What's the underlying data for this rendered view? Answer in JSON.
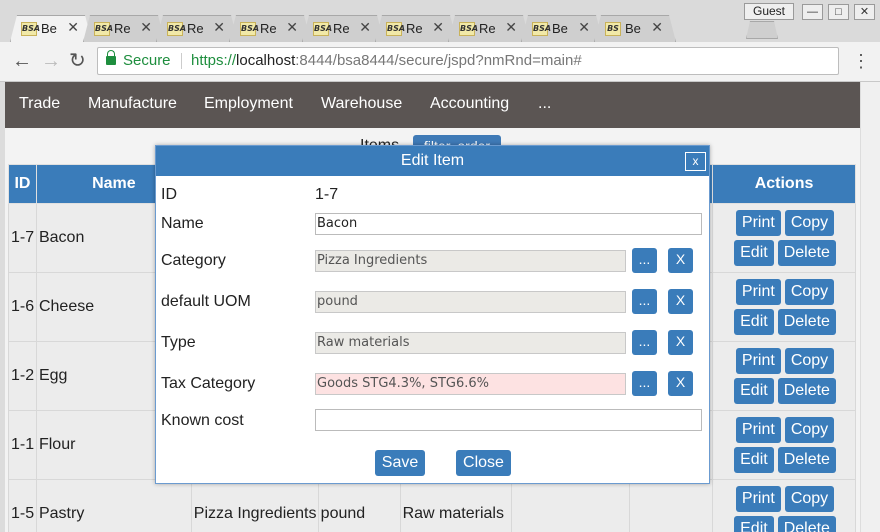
{
  "browser": {
    "tabs": [
      {
        "favicon": "BSA",
        "title": "Be"
      },
      {
        "favicon": "BSA",
        "title": "Re"
      },
      {
        "favicon": "BSA",
        "title": "Re"
      },
      {
        "favicon": "BSA",
        "title": "Re"
      },
      {
        "favicon": "BSA",
        "title": "Re"
      },
      {
        "favicon": "BSA",
        "title": "Re"
      },
      {
        "favicon": "BSA",
        "title": "Re"
      },
      {
        "favicon": "BSA",
        "title": "Be"
      },
      {
        "favicon": "BS",
        "title": "Be"
      }
    ],
    "active_tab": 0,
    "profile": "Guest",
    "secure_label": "Secure",
    "url_scheme": "https://",
    "url_host": "localhost",
    "url_rest": ":8444/bsa8444/secure/jspd?nmRnd=main#"
  },
  "nav": {
    "items": [
      "Trade",
      "Manufacture",
      "Employment",
      "Warehouse",
      "Accounting",
      "..."
    ]
  },
  "page": {
    "title": "Items",
    "filter_button": "filter, order",
    "columns": {
      "id": "ID",
      "name": "Name",
      "actions": "Actions"
    },
    "rows": [
      {
        "id": "1-7",
        "name": "Bacon",
        "category": "",
        "uom": "",
        "type": ""
      },
      {
        "id": "1-6",
        "name": "Cheese",
        "category": "",
        "uom": "",
        "type": ""
      },
      {
        "id": "1-2",
        "name": "Egg",
        "category": "",
        "uom": "",
        "type": ""
      },
      {
        "id": "1-1",
        "name": "Flour",
        "category": "",
        "uom": "",
        "type": ""
      },
      {
        "id": "1-5",
        "name": "Pastry",
        "category": "Pizza Ingredients",
        "uom": "pound",
        "type": "Raw materials"
      }
    ],
    "actions": {
      "print": "Print",
      "copy": "Copy",
      "edit": "Edit",
      "delete": "Delete"
    }
  },
  "dialog": {
    "title": "Edit Item",
    "close": "x",
    "id_label": "ID",
    "id_value": "1-7",
    "name_label": "Name",
    "name_value": "Bacon",
    "category_label": "Category",
    "category_value": "Pizza Ingredients",
    "uom_label": "default UOM",
    "uom_value": "pound",
    "type_label": "Type",
    "type_value": "Raw materials",
    "tax_label": "Tax Category",
    "tax_value": "Goods STG4.3%, STG6.6%",
    "cost_label": "Known cost",
    "cost_value": "",
    "pick_label": "...",
    "clear_label": "X",
    "save": "Save",
    "close_button": "Close"
  }
}
